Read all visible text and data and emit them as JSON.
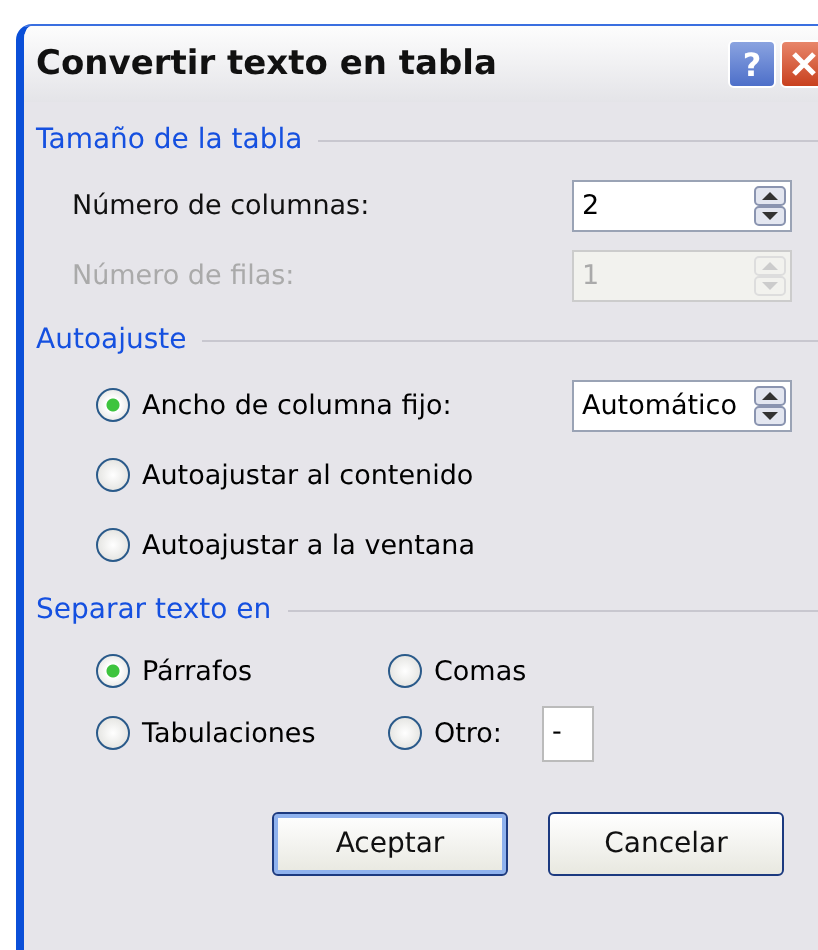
{
  "window": {
    "title": "Convertir texto en tabla",
    "help_button": "?"
  },
  "table_size": {
    "heading": "Tamaño de la tabla",
    "fields": [
      {
        "label": "Número de columnas:",
        "value": "2",
        "disabled": false
      },
      {
        "label": "Número de filas:",
        "value": "1",
        "disabled": true
      }
    ]
  },
  "autofit": {
    "heading": "Autoajuste",
    "options": [
      {
        "label": "Ancho de columna fijo:",
        "selected": true,
        "spinner_value": "Automático"
      },
      {
        "label": "Autoajustar al contenido",
        "selected": false
      },
      {
        "label": "Autoajustar a la ventana",
        "selected": false
      }
    ]
  },
  "separate": {
    "heading": "Separar texto en",
    "options": [
      {
        "label": "Párrafos",
        "selected": true
      },
      {
        "label": "Comas",
        "selected": false
      },
      {
        "label": "Tabulaciones",
        "selected": false
      },
      {
        "label": "Otro:",
        "selected": false,
        "value": "-"
      }
    ]
  },
  "buttons": [
    {
      "label": "Aceptar",
      "default": true
    },
    {
      "label": "Cancelar",
      "default": false
    }
  ]
}
